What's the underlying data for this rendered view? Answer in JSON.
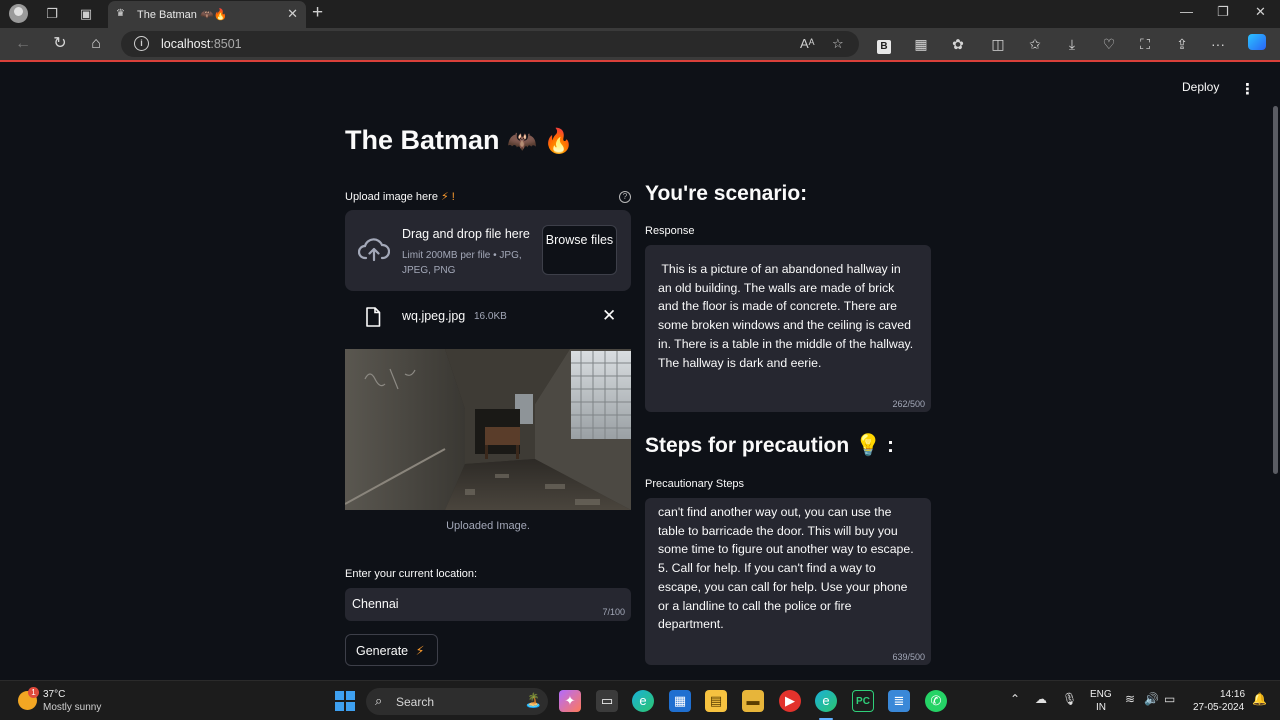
{
  "browser": {
    "tab_title": "The Batman 🦇🔥",
    "tab_favicon": "streamlit-crown-icon",
    "url_host": "localhost",
    "url_port": ":8501",
    "read_aloud": "Aᴬ"
  },
  "app": {
    "deploy_label": "Deploy",
    "menu_icon": "⋮",
    "title": "The Batman",
    "title_emoji": "🦇 🔥"
  },
  "upload": {
    "label": "Upload image here",
    "label_emoji": "⚡ !",
    "help": "?",
    "drop_title": "Drag and drop file here",
    "drop_sub": "Limit 200MB per file • JPG, JPEG, PNG",
    "browse_label": "Browse files",
    "file_name": "wq.jpeg.jpg",
    "file_size": "16.0KB",
    "remove": "✕",
    "caption": "Uploaded Image."
  },
  "location": {
    "label": "Enter your current location:",
    "value": "Chennai",
    "count": "7/100"
  },
  "generate": {
    "label": "Generate",
    "emoji": "⚡"
  },
  "scenario": {
    "heading": "You're scenario:",
    "label": "Response",
    "text": " This is a picture of an abandoned hallway in an old building. The walls are made of brick and the floor is made of concrete. There are some broken windows and the ceiling is caved in. There is a table in the middle of the hallway. The hallway is dark and eerie.",
    "count": "262/500"
  },
  "precaution": {
    "heading": "Steps for precaution",
    "heading_emoji": "💡 :",
    "label": "Precautionary Steps",
    "text": "can't find another way out, you can use the table to barricade the door. This will buy you some time to figure out another way to escape.\n5. Call for help. If you can't find a way to escape, you can call for help. Use your phone or a landline to call the police or fire department.",
    "count": "639/500"
  },
  "taskbar": {
    "temp": "37°C",
    "weather": "Mostly sunny",
    "weather_badge": "1",
    "search": "Search",
    "lang_top": "ENG",
    "lang_bottom": "IN",
    "time": "14:16",
    "date": "27-05-2024"
  },
  "colors": {
    "background": "#0e1117",
    "widget_bg": "#262730",
    "text": "#fafafa",
    "muted": "#a3a8b8",
    "accent_load": "#d9403a"
  }
}
